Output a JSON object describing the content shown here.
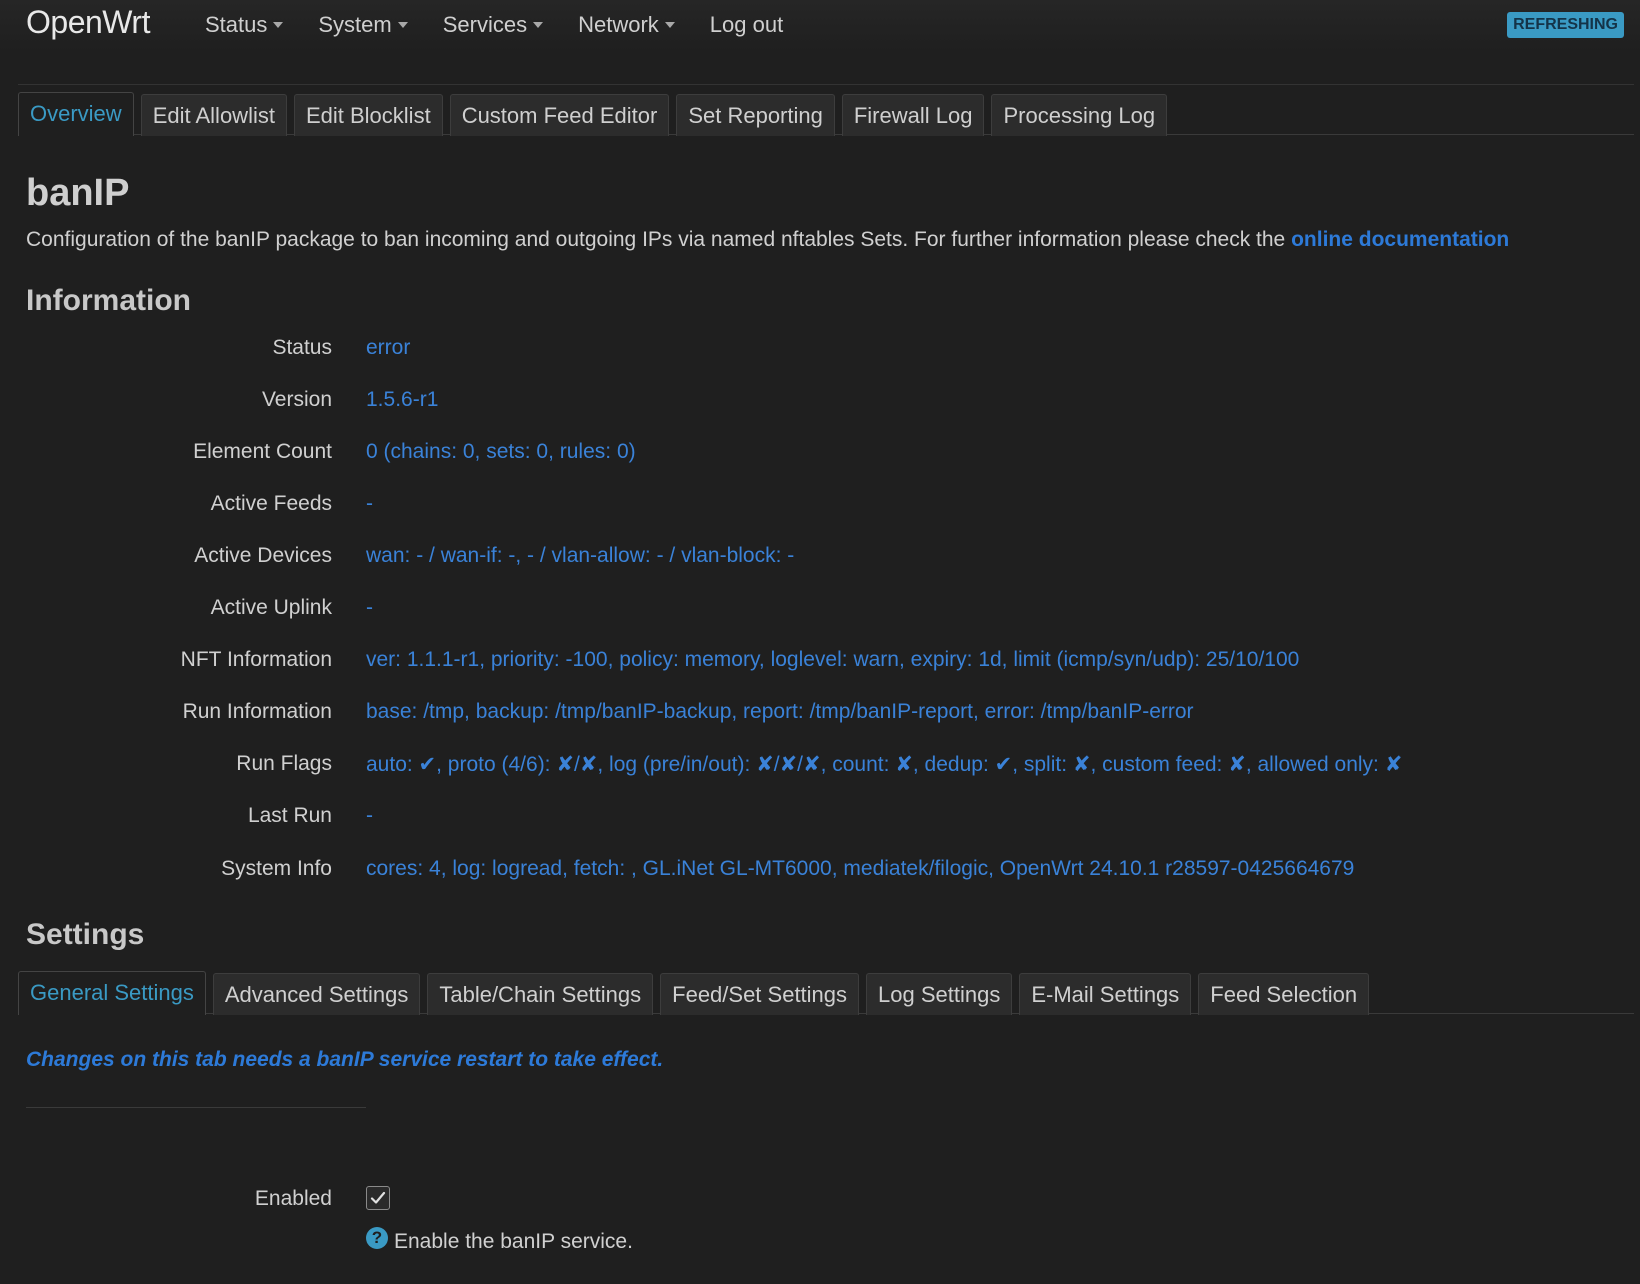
{
  "header": {
    "brand": "OpenWrt",
    "menu": [
      {
        "label": "Status",
        "dropdown": true
      },
      {
        "label": "System",
        "dropdown": true
      },
      {
        "label": "Services",
        "dropdown": true
      },
      {
        "label": "Network",
        "dropdown": true
      },
      {
        "label": "Log out",
        "dropdown": false
      }
    ],
    "indicator": "REFRESHING"
  },
  "main_tabs": [
    {
      "label": "Overview",
      "active": true
    },
    {
      "label": "Edit Allowlist",
      "active": false
    },
    {
      "label": "Edit Blocklist",
      "active": false
    },
    {
      "label": "Custom Feed Editor",
      "active": false
    },
    {
      "label": "Set Reporting",
      "active": false
    },
    {
      "label": "Firewall Log",
      "active": false
    },
    {
      "label": "Processing Log",
      "active": false
    }
  ],
  "page": {
    "title": "banIP",
    "description": "Configuration of the banIP package to ban incoming and outgoing IPs via named nftables Sets. For further information please check the",
    "doc_link": "online documentation"
  },
  "information": {
    "title": "Information",
    "rows": [
      {
        "label": "Status",
        "value": "error"
      },
      {
        "label": "Version",
        "value": "1.5.6-r1"
      },
      {
        "label": "Element Count",
        "value": "0 (chains: 0, sets: 0, rules: 0)"
      },
      {
        "label": "Active Feeds",
        "value": "-"
      },
      {
        "label": "Active Devices",
        "value": "wan: - / wan-if: -, - / vlan-allow: - / vlan-block: -"
      },
      {
        "label": "Active Uplink",
        "value": "-"
      },
      {
        "label": "NFT Information",
        "value": "ver: 1.1.1-r1, priority: -100, policy: memory, loglevel: warn, expiry: 1d, limit (icmp/syn/udp): 25/10/100"
      },
      {
        "label": "Run Information",
        "value": "base: /tmp, backup: /tmp/banIP-backup, report: /tmp/banIP-report, error: /tmp/banIP-error"
      },
      {
        "label": "Run Flags",
        "value": "auto: ✔, proto (4/6): ✘/✘, log (pre/in/out): ✘/✘/✘, count: ✘, dedup: ✔, split: ✘, custom feed: ✘, allowed only: ✘"
      },
      {
        "label": "Last Run",
        "value": "-"
      },
      {
        "label": "System Info",
        "value": "cores: 4, log: logread, fetch: , GL.iNet GL-MT6000, mediatek/filogic, OpenWrt 24.10.1 r28597-0425664679"
      }
    ]
  },
  "settings": {
    "title": "Settings",
    "tabs": [
      {
        "label": "General Settings",
        "active": true
      },
      {
        "label": "Advanced Settings",
        "active": false
      },
      {
        "label": "Table/Chain Settings",
        "active": false
      },
      {
        "label": "Feed/Set Settings",
        "active": false
      },
      {
        "label": "Log Settings",
        "active": false
      },
      {
        "label": "E-Mail Settings",
        "active": false
      },
      {
        "label": "Feed Selection",
        "active": false
      }
    ],
    "note": "Changes on this tab needs a banIP service restart to take effect.",
    "enabled": {
      "label": "Enabled",
      "checked": true,
      "help": "Enable the banIP service."
    }
  },
  "colors": {
    "accent": "#3a9ac4",
    "value_blue": "#3a82d8",
    "link_blue": "#2d7ad8",
    "background": "#1f1f1f"
  }
}
